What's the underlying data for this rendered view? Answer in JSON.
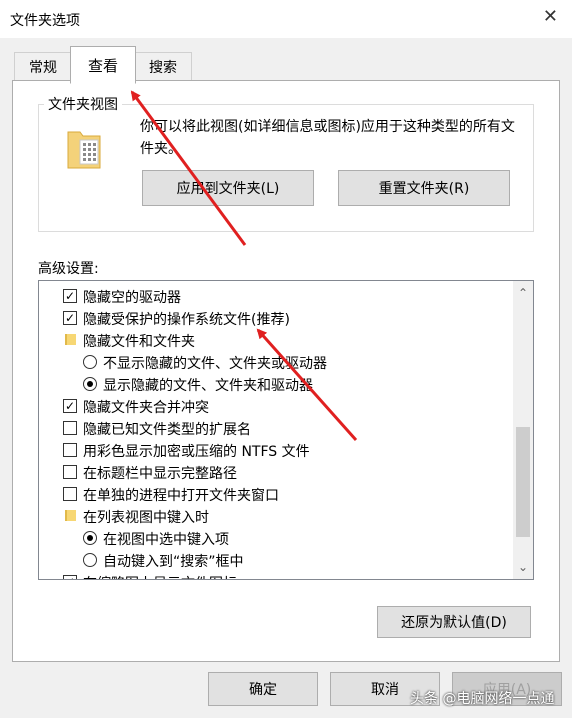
{
  "window": {
    "title": "文件夹选项"
  },
  "tabs": [
    {
      "label": "常规"
    },
    {
      "label": "查看"
    },
    {
      "label": "搜索"
    }
  ],
  "folder_view": {
    "label": "文件夹视图",
    "description": "你可以将此视图(如详细信息或图标)应用于这种类型的所有文件夹。",
    "apply_button": "应用到文件夹(L)",
    "reset_button": "重置文件夹(R)"
  },
  "advanced": {
    "label": "高级设置:",
    "items": [
      {
        "type": "checkbox",
        "checked": true,
        "label": "隐藏空的驱动器"
      },
      {
        "type": "checkbox",
        "checked": true,
        "label": "隐藏受保护的操作系统文件(推荐)"
      },
      {
        "type": "folder",
        "label": "隐藏文件和文件夹"
      },
      {
        "type": "radio",
        "checked": false,
        "label": "不显示隐藏的文件、文件夹或驱动器"
      },
      {
        "type": "radio",
        "checked": true,
        "label": "显示隐藏的文件、文件夹和驱动器"
      },
      {
        "type": "checkbox",
        "checked": true,
        "label": "隐藏文件夹合并冲突"
      },
      {
        "type": "checkbox",
        "checked": false,
        "label": "隐藏已知文件类型的扩展名"
      },
      {
        "type": "checkbox",
        "checked": false,
        "label": "用彩色显示加密或压缩的 NTFS 文件"
      },
      {
        "type": "checkbox",
        "checked": false,
        "label": "在标题栏中显示完整路径"
      },
      {
        "type": "checkbox",
        "checked": false,
        "label": "在单独的进程中打开文件夹窗口"
      },
      {
        "type": "folder",
        "label": "在列表视图中键入时"
      },
      {
        "type": "radio",
        "checked": true,
        "label": "在视图中选中键入项"
      },
      {
        "type": "radio",
        "checked": false,
        "label": "自动键入到“搜索”框中"
      },
      {
        "type": "checkbox",
        "checked": true,
        "label": "在缩略图上显示文件图标"
      }
    ]
  },
  "restore_button": "还原为默认值(D)",
  "footer": {
    "ok": "确定",
    "cancel": "取消",
    "apply": "应用(A)"
  },
  "watermark": "头条 @电脑网络一点通",
  "colors": {
    "annotation_arrow": "#e02020"
  }
}
